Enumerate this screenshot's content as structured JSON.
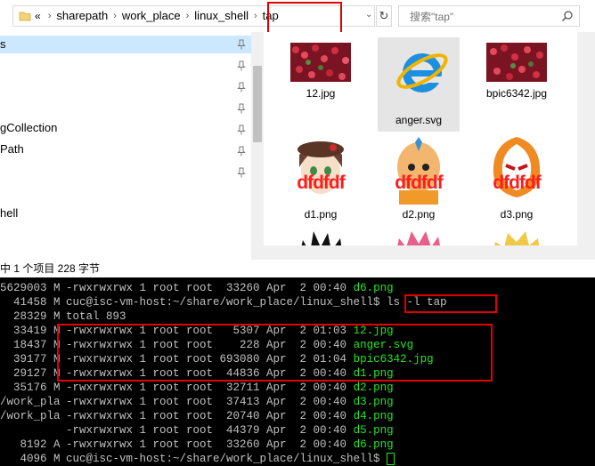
{
  "address": {
    "overflow": "«",
    "crumbs": [
      "sharepath",
      "work_place",
      "linux_shell",
      "tap"
    ],
    "separator": "›",
    "dropdown": "⌄",
    "refresh": "↻"
  },
  "search": {
    "placeholder": "搜索\"tap\""
  },
  "nav": {
    "items": [
      {
        "label": "s"
      },
      {
        "label": ""
      },
      {
        "label": ""
      },
      {
        "label": ""
      },
      {
        "label": "gCollection"
      },
      {
        "label": "Path"
      },
      {
        "label": ""
      },
      {
        "label": ""
      },
      {
        "label": "hell"
      }
    ]
  },
  "files": [
    {
      "name": "12.jpg",
      "kind": "berries"
    },
    {
      "name": "anger.svg",
      "kind": "ie-logo"
    },
    {
      "name": "bpic6342.jpg",
      "kind": "berries"
    },
    {
      "name": "d1.png",
      "kind": "avatar-girl",
      "overlay": "dfdfdf"
    },
    {
      "name": "d2.png",
      "kind": "avatar-bald",
      "overlay": "dfdfdf"
    },
    {
      "name": "d3.png",
      "kind": "avatar-mask",
      "overlay": "dfdfdf"
    },
    {
      "name": "",
      "kind": "avatar-spiky"
    },
    {
      "name": "",
      "kind": "avatar-pink"
    },
    {
      "name": "",
      "kind": "avatar-blond"
    }
  ],
  "status": {
    "text": "中 1 个项目   228 字节"
  },
  "terminal": {
    "left_col": [
      "5629003 M",
      "  41458 M",
      "  28329 M",
      "  33419 M",
      "  18437 M",
      "  39177 M",
      "  29127 M",
      "  35176 M",
      "/work_pla",
      "/work_pla",
      "",
      "   8192 A",
      "   4096 M"
    ],
    "lines": [
      {
        "text": "-rwxrwxrwx 1 root root  33260 Apr  2 00:40 ",
        "file": "d6.png"
      },
      {
        "text": "cuc@isc-vm-host:~/share/work_place/linux_shell$ ls -l tap",
        "file": ""
      },
      {
        "text": "total 893",
        "file": ""
      },
      {
        "text": "-rwxrwxrwx 1 root root   5307 Apr  2 01:03 ",
        "file": "12.jpg"
      },
      {
        "text": "-rwxrwxrwx 1 root root    228 Apr  2 00:40 ",
        "file": "anger.svg"
      },
      {
        "text": "-rwxrwxrwx 1 root root 693080 Apr  2 01:04 ",
        "file": "bpic6342.jpg"
      },
      {
        "text": "-rwxrwxrwx 1 root root  44836 Apr  2 00:40 ",
        "file": "d1.png"
      },
      {
        "text": "-rwxrwxrwx 1 root root  32711 Apr  2 00:40 ",
        "file": "d2.png"
      },
      {
        "text": "-rwxrwxrwx 1 root root  37413 Apr  2 00:40 ",
        "file": "d3.png"
      },
      {
        "text": "-rwxrwxrwx 1 root root  20740 Apr  2 00:40 ",
        "file": "d4.png"
      },
      {
        "text": "-rwxrwxrwx 1 root root  44379 Apr  2 00:40 ",
        "file": "d5.png"
      },
      {
        "text": "-rwxrwxrwx 1 root root  33260 Apr  2 00:40 ",
        "file": "d6.png"
      },
      {
        "text": "cuc@isc-vm-host:~/share/work_place/linux_shell$ ",
        "file": ""
      }
    ]
  },
  "colors": {
    "highlight": "#e00000",
    "terminal_file": "#22e622",
    "selection": "#cce8ff"
  }
}
